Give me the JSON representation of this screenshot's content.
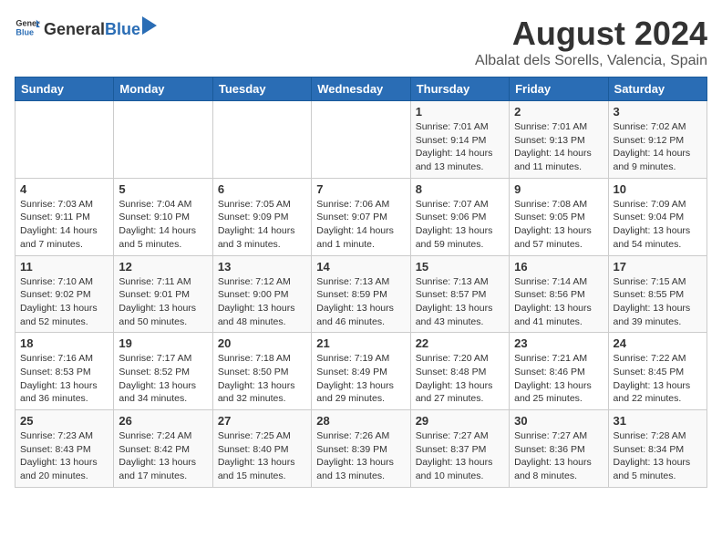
{
  "header": {
    "logo_general": "General",
    "logo_blue": "Blue",
    "title": "August 2024",
    "subtitle": "Albalat dels Sorells, Valencia, Spain"
  },
  "weekdays": [
    "Sunday",
    "Monday",
    "Tuesday",
    "Wednesday",
    "Thursday",
    "Friday",
    "Saturday"
  ],
  "weeks": [
    [
      {
        "day": "",
        "info": ""
      },
      {
        "day": "",
        "info": ""
      },
      {
        "day": "",
        "info": ""
      },
      {
        "day": "",
        "info": ""
      },
      {
        "day": "1",
        "info": "Sunrise: 7:01 AM\nSunset: 9:14 PM\nDaylight: 14 hours\nand 13 minutes."
      },
      {
        "day": "2",
        "info": "Sunrise: 7:01 AM\nSunset: 9:13 PM\nDaylight: 14 hours\nand 11 minutes."
      },
      {
        "day": "3",
        "info": "Sunrise: 7:02 AM\nSunset: 9:12 PM\nDaylight: 14 hours\nand 9 minutes."
      }
    ],
    [
      {
        "day": "4",
        "info": "Sunrise: 7:03 AM\nSunset: 9:11 PM\nDaylight: 14 hours\nand 7 minutes."
      },
      {
        "day": "5",
        "info": "Sunrise: 7:04 AM\nSunset: 9:10 PM\nDaylight: 14 hours\nand 5 minutes."
      },
      {
        "day": "6",
        "info": "Sunrise: 7:05 AM\nSunset: 9:09 PM\nDaylight: 14 hours\nand 3 minutes."
      },
      {
        "day": "7",
        "info": "Sunrise: 7:06 AM\nSunset: 9:07 PM\nDaylight: 14 hours\nand 1 minute."
      },
      {
        "day": "8",
        "info": "Sunrise: 7:07 AM\nSunset: 9:06 PM\nDaylight: 13 hours\nand 59 minutes."
      },
      {
        "day": "9",
        "info": "Sunrise: 7:08 AM\nSunset: 9:05 PM\nDaylight: 13 hours\nand 57 minutes."
      },
      {
        "day": "10",
        "info": "Sunrise: 7:09 AM\nSunset: 9:04 PM\nDaylight: 13 hours\nand 54 minutes."
      }
    ],
    [
      {
        "day": "11",
        "info": "Sunrise: 7:10 AM\nSunset: 9:02 PM\nDaylight: 13 hours\nand 52 minutes."
      },
      {
        "day": "12",
        "info": "Sunrise: 7:11 AM\nSunset: 9:01 PM\nDaylight: 13 hours\nand 50 minutes."
      },
      {
        "day": "13",
        "info": "Sunrise: 7:12 AM\nSunset: 9:00 PM\nDaylight: 13 hours\nand 48 minutes."
      },
      {
        "day": "14",
        "info": "Sunrise: 7:13 AM\nSunset: 8:59 PM\nDaylight: 13 hours\nand 46 minutes."
      },
      {
        "day": "15",
        "info": "Sunrise: 7:13 AM\nSunset: 8:57 PM\nDaylight: 13 hours\nand 43 minutes."
      },
      {
        "day": "16",
        "info": "Sunrise: 7:14 AM\nSunset: 8:56 PM\nDaylight: 13 hours\nand 41 minutes."
      },
      {
        "day": "17",
        "info": "Sunrise: 7:15 AM\nSunset: 8:55 PM\nDaylight: 13 hours\nand 39 minutes."
      }
    ],
    [
      {
        "day": "18",
        "info": "Sunrise: 7:16 AM\nSunset: 8:53 PM\nDaylight: 13 hours\nand 36 minutes."
      },
      {
        "day": "19",
        "info": "Sunrise: 7:17 AM\nSunset: 8:52 PM\nDaylight: 13 hours\nand 34 minutes."
      },
      {
        "day": "20",
        "info": "Sunrise: 7:18 AM\nSunset: 8:50 PM\nDaylight: 13 hours\nand 32 minutes."
      },
      {
        "day": "21",
        "info": "Sunrise: 7:19 AM\nSunset: 8:49 PM\nDaylight: 13 hours\nand 29 minutes."
      },
      {
        "day": "22",
        "info": "Sunrise: 7:20 AM\nSunset: 8:48 PM\nDaylight: 13 hours\nand 27 minutes."
      },
      {
        "day": "23",
        "info": "Sunrise: 7:21 AM\nSunset: 8:46 PM\nDaylight: 13 hours\nand 25 minutes."
      },
      {
        "day": "24",
        "info": "Sunrise: 7:22 AM\nSunset: 8:45 PM\nDaylight: 13 hours\nand 22 minutes."
      }
    ],
    [
      {
        "day": "25",
        "info": "Sunrise: 7:23 AM\nSunset: 8:43 PM\nDaylight: 13 hours\nand 20 minutes."
      },
      {
        "day": "26",
        "info": "Sunrise: 7:24 AM\nSunset: 8:42 PM\nDaylight: 13 hours\nand 17 minutes."
      },
      {
        "day": "27",
        "info": "Sunrise: 7:25 AM\nSunset: 8:40 PM\nDaylight: 13 hours\nand 15 minutes."
      },
      {
        "day": "28",
        "info": "Sunrise: 7:26 AM\nSunset: 8:39 PM\nDaylight: 13 hours\nand 13 minutes."
      },
      {
        "day": "29",
        "info": "Sunrise: 7:27 AM\nSunset: 8:37 PM\nDaylight: 13 hours\nand 10 minutes."
      },
      {
        "day": "30",
        "info": "Sunrise: 7:27 AM\nSunset: 8:36 PM\nDaylight: 13 hours\nand 8 minutes."
      },
      {
        "day": "31",
        "info": "Sunrise: 7:28 AM\nSunset: 8:34 PM\nDaylight: 13 hours\nand 5 minutes."
      }
    ]
  ]
}
